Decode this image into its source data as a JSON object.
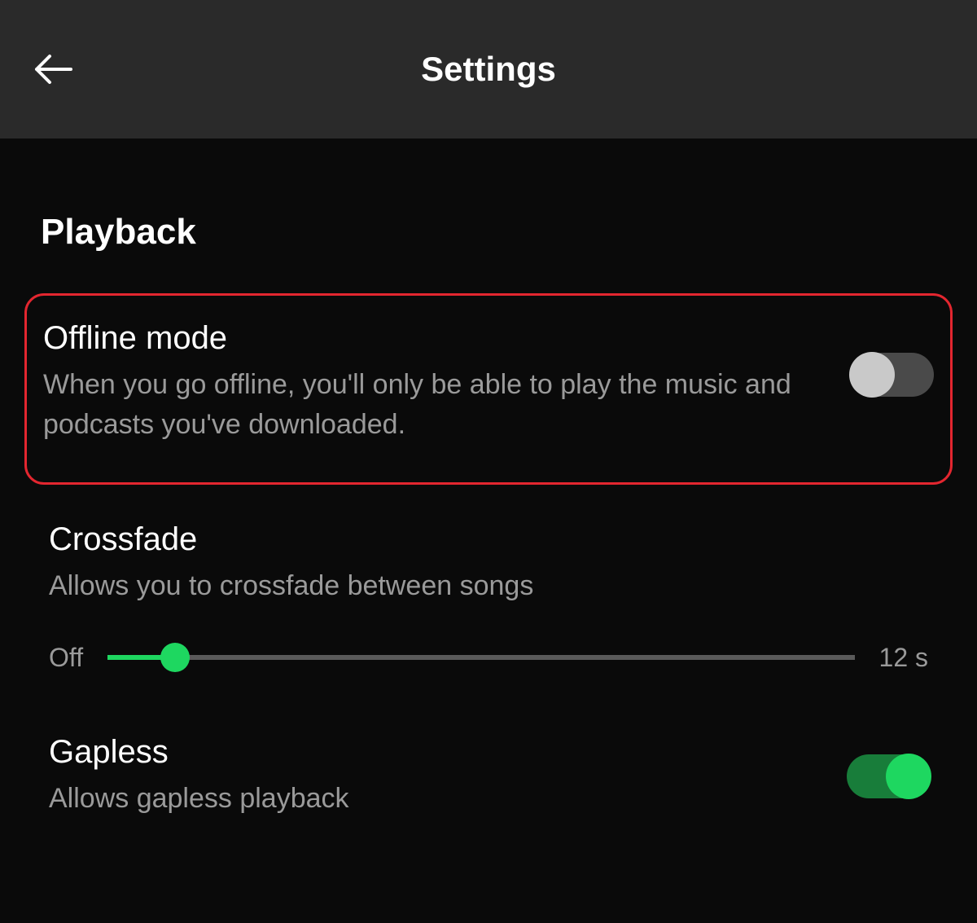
{
  "header": {
    "title": "Settings"
  },
  "section": {
    "title": "Playback"
  },
  "offline": {
    "title": "Offline mode",
    "description": "When you go offline, you'll only be able to play the music and podcasts you've downloaded.",
    "enabled": false
  },
  "crossfade": {
    "title": "Crossfade",
    "description": "Allows you to crossfade between songs",
    "minLabel": "Off",
    "maxLabel": "12 s",
    "sliderPercent": 9
  },
  "gapless": {
    "title": "Gapless",
    "description": "Allows gapless playback",
    "enabled": true
  },
  "colors": {
    "accent": "#1ed760",
    "highlight": "#e3262f"
  }
}
